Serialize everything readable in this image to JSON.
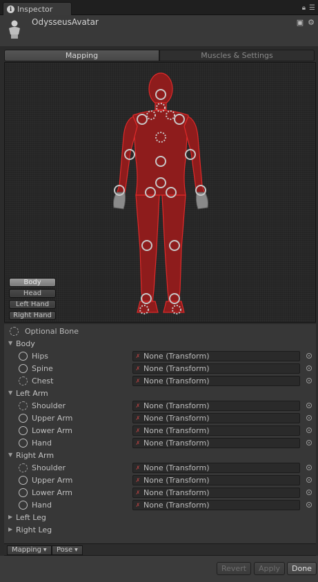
{
  "window": {
    "tab_title": "Inspector"
  },
  "header": {
    "asset_name": "OdysseusAvatar"
  },
  "mode_tabs": [
    {
      "label": "Mapping"
    },
    {
      "label": "Muscles & Settings"
    }
  ],
  "body_parts": [
    {
      "label": "Body",
      "active": true
    },
    {
      "label": "Head"
    },
    {
      "label": "Left Hand"
    },
    {
      "label": "Right Hand"
    }
  ],
  "optional_bone_label": "Optional Bone",
  "groups": [
    {
      "label": "Body",
      "expanded": true,
      "bones": [
        {
          "label": "Hips",
          "optional": false,
          "value": "None (Transform)"
        },
        {
          "label": "Spine",
          "optional": false,
          "value": "None (Transform)"
        },
        {
          "label": "Chest",
          "optional": true,
          "value": "None (Transform)"
        }
      ]
    },
    {
      "label": "Left Arm",
      "expanded": true,
      "bones": [
        {
          "label": "Shoulder",
          "optional": true,
          "value": "None (Transform)"
        },
        {
          "label": "Upper Arm",
          "optional": false,
          "value": "None (Transform)"
        },
        {
          "label": "Lower Arm",
          "optional": false,
          "value": "None (Transform)"
        },
        {
          "label": "Hand",
          "optional": false,
          "value": "None (Transform)"
        }
      ]
    },
    {
      "label": "Right Arm",
      "expanded": true,
      "bones": [
        {
          "label": "Shoulder",
          "optional": true,
          "value": "None (Transform)"
        },
        {
          "label": "Upper Arm",
          "optional": false,
          "value": "None (Transform)"
        },
        {
          "label": "Lower Arm",
          "optional": false,
          "value": "None (Transform)"
        },
        {
          "label": "Hand",
          "optional": false,
          "value": "None (Transform)"
        }
      ]
    },
    {
      "label": "Left Leg",
      "expanded": false,
      "bones": []
    },
    {
      "label": "Right Leg",
      "expanded": false,
      "bones": []
    }
  ],
  "bottom_toolbar": {
    "mapping_label": "Mapping",
    "pose_label": "Pose"
  },
  "footer": {
    "revert_label": "Revert",
    "apply_label": "Apply",
    "done_label": "Done"
  },
  "colors": {
    "figure_red": "#8e1c1c",
    "figure_outline": "#e02a2a",
    "panel": "#373737"
  }
}
